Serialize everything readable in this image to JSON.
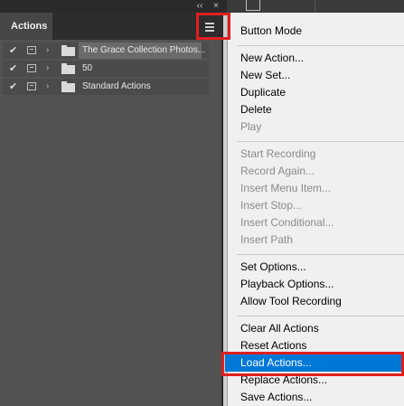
{
  "panel": {
    "title": "Actions",
    "collapse_glyph": "‹‹",
    "close_glyph": "×",
    "menu_icon": "hamburger-menu-icon",
    "rows": [
      {
        "name": "The Grace Collection Photos...",
        "enabled": true,
        "selected": true
      },
      {
        "name": "50",
        "enabled": true,
        "selected": false
      },
      {
        "name": "Standard Actions",
        "enabled": true,
        "selected": false
      }
    ]
  },
  "menu": {
    "groups": [
      [
        {
          "label": "Button Mode",
          "enabled": true
        }
      ],
      [
        {
          "label": "New Action...",
          "enabled": true
        },
        {
          "label": "New Set...",
          "enabled": true
        },
        {
          "label": "Duplicate",
          "enabled": true
        },
        {
          "label": "Delete",
          "enabled": true
        },
        {
          "label": "Play",
          "enabled": false
        }
      ],
      [
        {
          "label": "Start Recording",
          "enabled": false
        },
        {
          "label": "Record Again...",
          "enabled": false
        },
        {
          "label": "Insert Menu Item...",
          "enabled": false
        },
        {
          "label": "Insert Stop...",
          "enabled": false
        },
        {
          "label": "Insert Conditional...",
          "enabled": false
        },
        {
          "label": "Insert Path",
          "enabled": false
        }
      ],
      [
        {
          "label": "Set Options...",
          "enabled": true
        },
        {
          "label": "Playback Options...",
          "enabled": true
        },
        {
          "label": "Allow Tool Recording",
          "enabled": true
        }
      ],
      [
        {
          "label": "Clear All Actions",
          "enabled": true
        },
        {
          "label": "Reset Actions",
          "enabled": true
        },
        {
          "label": "Load Actions...",
          "enabled": true,
          "highlighted": true
        },
        {
          "label": "Replace Actions...",
          "enabled": true
        },
        {
          "label": "Save Actions...",
          "enabled": true
        }
      ]
    ]
  },
  "colors": {
    "highlight_box": "#e01f1f",
    "menu_active": "#0078d7"
  }
}
